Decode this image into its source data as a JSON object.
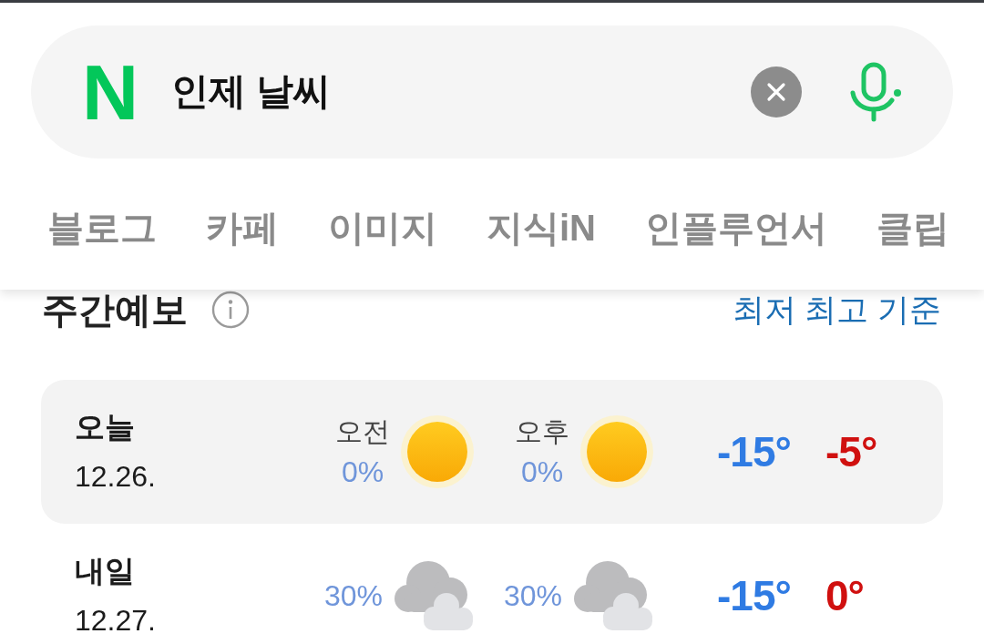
{
  "search": {
    "logo": "N",
    "query": "인제 날씨"
  },
  "tabs": [
    {
      "label": "블로그"
    },
    {
      "label": "카페"
    },
    {
      "label": "이미지"
    },
    {
      "label": "지식iN"
    },
    {
      "label": "인플루언서"
    },
    {
      "label": "클립"
    }
  ],
  "weekly_forecast": {
    "title": "주간예보",
    "sort_link": "최저 최고 기준",
    "days": [
      {
        "day": "오늘",
        "date": "12.26.",
        "highlighted": true,
        "periods": [
          {
            "label": "오전",
            "rain": "0%",
            "kind": "sunny"
          },
          {
            "label": "오후",
            "rain": "0%",
            "kind": "sunny"
          }
        ],
        "low": "-15°",
        "high": "-5°"
      },
      {
        "day": "내일",
        "date": "12.27.",
        "highlighted": false,
        "periods": [
          {
            "rain": "30%",
            "kind": "cloudy"
          },
          {
            "rain": "30%",
            "kind": "cloudy"
          }
        ],
        "low": "-15°",
        "high": "0°"
      }
    ]
  }
}
